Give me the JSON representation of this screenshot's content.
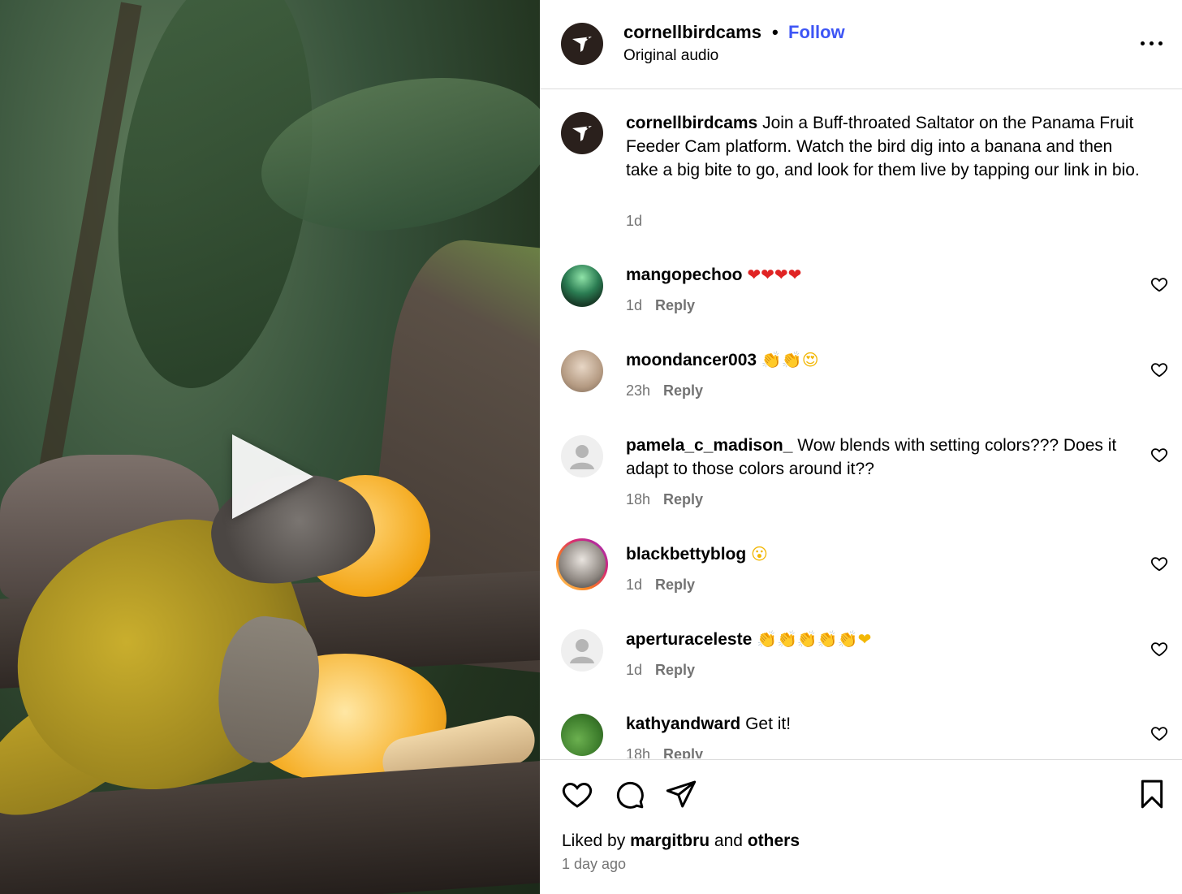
{
  "post": {
    "username": "cornellbirdcams",
    "separator": "•",
    "follow_label": "Follow",
    "audio": "Original audio",
    "more_icon": "more-horizontal-icon"
  },
  "caption": {
    "username": "cornellbirdcams",
    "text": "Join a Buff-throated Saltator on the Panama Fruit Feeder Cam platform. Watch the bird dig into a banana and then take a big bite to go, and look for them live by tapping our link in bio.",
    "time": "1d"
  },
  "comments": [
    {
      "username": "mangopechoo",
      "text": "",
      "emoji": "❤❤❤❤",
      "emoji_color": "#e02424",
      "time": "1d",
      "reply": "Reply"
    },
    {
      "username": "moondancer003",
      "text": "",
      "emoji": "👏👏😍",
      "emoji_color": "#f2b705",
      "time": "23h",
      "reply": "Reply"
    },
    {
      "username": "pamela_c_madison_",
      "text": "Wow blends with setting colors??? Does it adapt to those colors around it??",
      "emoji": "",
      "time": "18h",
      "reply": "Reply"
    },
    {
      "username": "blackbettyblog",
      "text": "",
      "emoji": "😮",
      "emoji_color": "#f2b705",
      "time": "1d",
      "reply": "Reply"
    },
    {
      "username": "aperturaceleste",
      "text": "",
      "emoji": "👏👏👏👏👏❤",
      "emoji_color": "#f2b705",
      "time": "1d",
      "reply": "Reply"
    },
    {
      "username": "kathyandward",
      "text": "Get it!",
      "emoji": "",
      "time": "18h",
      "reply": "Reply"
    }
  ],
  "footer": {
    "liked_prefix": "Liked by",
    "liked_user": "margitbru",
    "liked_and": "and",
    "liked_others": "others",
    "posted": "1 day ago"
  },
  "colors": {
    "follow": "#3d55f5",
    "muted": "#737373",
    "divider": "#dbdbdb"
  }
}
